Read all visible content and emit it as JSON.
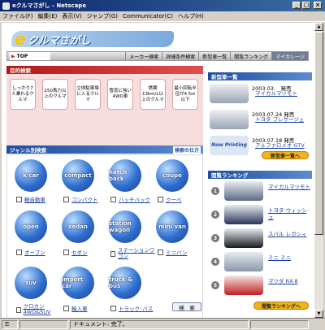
{
  "window": {
    "title": "eクルマさがし - Netscape"
  },
  "menu": [
    "ファイル(F)",
    "編集(E)",
    "表示(V)",
    "ジャンプ(G)",
    "Communicator(C)",
    "ヘルプ(H)"
  ],
  "logo": {
    "mark": "e",
    "name": "クルマさがし"
  },
  "nav": {
    "home": "TOP",
    "links": [
      "メーカー検索",
      "詳細条件検索",
      "新型車一覧",
      "閲覧ランキング",
      "マイカレージ"
    ]
  },
  "purpose": {
    "title": "目的検索",
    "items": [
      "しっかり7人乗れるクルマ",
      "250馬力以上のクルマ",
      "立体駐車場に入るクルマ",
      "雪道に強い4WD車",
      "燃費13km/L以上のクルマ",
      "最小回転半径が4.5m以下"
    ]
  },
  "genre": {
    "title": "ジャンル別検索",
    "manual_label": "検索の仕方",
    "items": [
      {
        "icon": "k car",
        "label": "軽自動車"
      },
      {
        "icon": "compact",
        "label": "コンパクト"
      },
      {
        "icon": "hatch back",
        "label": "ハッチバック"
      },
      {
        "icon": "coupe",
        "label": "クーペ"
      },
      {
        "icon": "open",
        "label": "オープン"
      },
      {
        "icon": "sedan",
        "label": "セダン"
      },
      {
        "icon": "station wagon",
        "label": "ステーションワゴン"
      },
      {
        "icon": "mini van",
        "label": "ミニバン"
      },
      {
        "icon": "suv",
        "label": "クロカン 4WD&SUV"
      },
      {
        "icon": "import car",
        "label": "輸入車"
      },
      {
        "icon": "truck & bus",
        "label": "トラック･バス"
      }
    ],
    "search_button": "検　索"
  },
  "newcars": {
    "title": "新型車一覧",
    "items": [
      {
        "date": "2003.03.　発売",
        "name": "マイカルマツモト"
      },
      {
        "date": "2003.07.24 発売",
        "name": "トヨタ プレサージュ"
      },
      {
        "date": "2003.07.18 発売",
        "name": "アルファロメオ GTV"
      }
    ],
    "printing_label": "Now Printing",
    "more_button": "新型車一覧へ"
  },
  "ranking": {
    "title": "閲覧ランキング",
    "items": [
      {
        "rank": "1",
        "name": "マイカルマツモト"
      },
      {
        "rank": "2",
        "name": "トヨタ ウィッシュ"
      },
      {
        "rank": "3",
        "name": "スバル レガシィ"
      },
      {
        "rank": "4",
        "name": "ミニ ミニ"
      },
      {
        "rank": "5",
        "name": "マツダ RX-8"
      }
    ],
    "more_button": "閲覧ランキングへ"
  },
  "status": {
    "text": "ドキュメント: 完了。"
  }
}
